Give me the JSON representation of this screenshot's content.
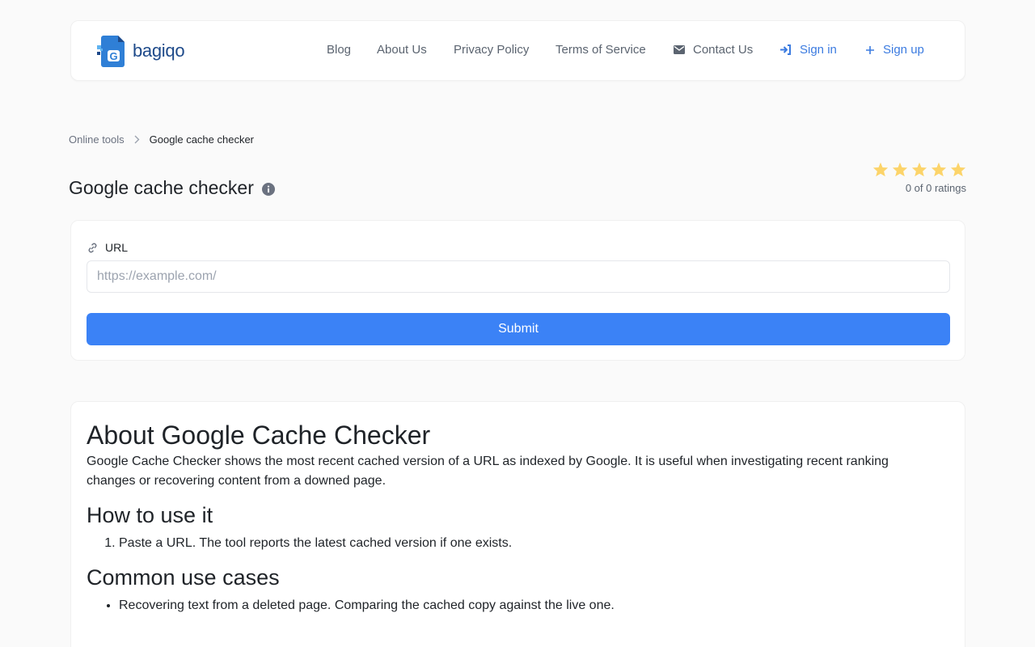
{
  "brand": {
    "name": "bagiqo"
  },
  "nav": {
    "blog": "Blog",
    "about": "About Us",
    "privacy": "Privacy Policy",
    "terms": "Terms of Service",
    "contact": "Contact Us",
    "signin": "Sign in",
    "signup": "Sign up"
  },
  "breadcrumb": {
    "parent": "Online tools",
    "current": "Google cache checker"
  },
  "page": {
    "title": "Google cache checker"
  },
  "rating": {
    "text": "0 of 0 ratings",
    "stars": 5,
    "star_color": "#fcd46a"
  },
  "form": {
    "label": "URL",
    "placeholder": "https://example.com/",
    "value": "",
    "submit": "Submit"
  },
  "about": {
    "heading": "About Google Cache Checker",
    "description": "Google Cache Checker shows the most recent cached version of a URL as indexed by Google. It is useful when investigating recent ranking changes or recovering content from a downed page.",
    "how_heading": "How to use it",
    "how_steps": [
      "Paste a URL. The tool reports the latest cached version if one exists."
    ],
    "uses_heading": "Common use cases",
    "uses": [
      "Recovering text from a deleted page. Comparing the cached copy against the live one."
    ]
  },
  "colors": {
    "accent": "#3b82f6",
    "link_blue": "#3b7be0",
    "nav_text": "#5b6470",
    "background": "#fafafa"
  },
  "icons": {
    "logo": "document-cache-icon",
    "contact": "envelope-icon",
    "signin": "sign-in-icon",
    "signup": "plus-icon",
    "breadcrumb_sep": "chevron-right-icon",
    "title_info": "info-circle-icon",
    "url_field": "link-icon",
    "rating": "star-icon"
  }
}
